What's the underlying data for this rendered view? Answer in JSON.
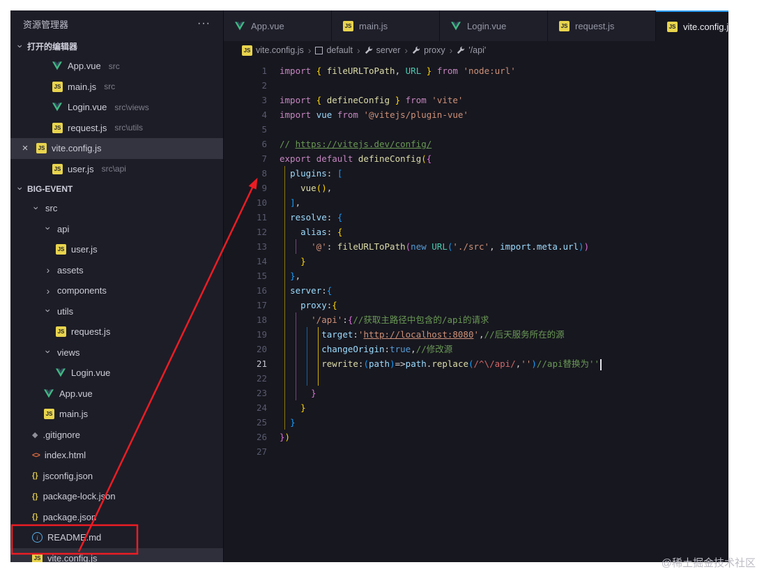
{
  "watermark": "@稀土掘金技术社区",
  "sidebar": {
    "title": "资源管理器",
    "more_icon": "···",
    "sections": {
      "open_editors": {
        "label": "打开的编辑器"
      },
      "workspace": {
        "label": "BIG-EVENT"
      }
    },
    "open_editors": [
      {
        "name": "App.vue",
        "path": "src",
        "icon": "vue"
      },
      {
        "name": "main.js",
        "path": "src",
        "icon": "js"
      },
      {
        "name": "Login.vue",
        "path": "src\\views",
        "icon": "vue"
      },
      {
        "name": "request.js",
        "path": "src\\utils",
        "icon": "js"
      },
      {
        "name": "vite.config.js",
        "path": "",
        "icon": "js",
        "active": true
      },
      {
        "name": "user.js",
        "path": "src\\api",
        "icon": "js"
      }
    ],
    "tree": [
      {
        "name": "src",
        "type": "folder",
        "expanded": true,
        "indent": 1
      },
      {
        "name": "api",
        "type": "folder",
        "expanded": true,
        "indent": 2
      },
      {
        "name": "user.js",
        "type": "file",
        "icon": "js",
        "indent": 3
      },
      {
        "name": "assets",
        "type": "folder",
        "expanded": false,
        "indent": 2
      },
      {
        "name": "components",
        "type": "folder",
        "expanded": false,
        "indent": 2
      },
      {
        "name": "utils",
        "type": "folder",
        "expanded": true,
        "indent": 2
      },
      {
        "name": "request.js",
        "type": "file",
        "icon": "js",
        "indent": 3
      },
      {
        "name": "views",
        "type": "folder",
        "expanded": true,
        "indent": 2
      },
      {
        "name": "Login.vue",
        "type": "file",
        "icon": "vue",
        "indent": 3
      },
      {
        "name": "App.vue",
        "type": "file",
        "icon": "vue",
        "indent": 2
      },
      {
        "name": "main.js",
        "type": "file",
        "icon": "js",
        "indent": 2
      },
      {
        "name": ".gitignore",
        "type": "file",
        "icon": "git",
        "indent": 1
      },
      {
        "name": "index.html",
        "type": "file",
        "icon": "html",
        "indent": 1
      },
      {
        "name": "jsconfig.json",
        "type": "file",
        "icon": "json",
        "indent": 1
      },
      {
        "name": "package-lock.json",
        "type": "file",
        "icon": "json",
        "indent": 1
      },
      {
        "name": "package.json",
        "type": "file",
        "icon": "json",
        "indent": 1
      },
      {
        "name": "README.md",
        "type": "file",
        "icon": "md",
        "indent": 1,
        "annotated": true
      },
      {
        "name": "vite.config.js",
        "type": "file",
        "icon": "js",
        "indent": 1,
        "selected": true
      }
    ]
  },
  "tabs": [
    {
      "label": "App.vue",
      "icon": "vue"
    },
    {
      "label": "main.js",
      "icon": "js"
    },
    {
      "label": "Login.vue",
      "icon": "vue"
    },
    {
      "label": "request.js",
      "icon": "js"
    },
    {
      "label": "vite.config.js",
      "icon": "js",
      "active": true
    }
  ],
  "breadcrumb": {
    "separator": "›",
    "items": [
      {
        "label": "vite.config.js",
        "icon": "js"
      },
      {
        "label": "default",
        "icon": "box"
      },
      {
        "label": "server",
        "icon": "wrench"
      },
      {
        "label": "proxy",
        "icon": "wrench"
      },
      {
        "label": "'/api'",
        "icon": "wrench"
      }
    ]
  },
  "editor": {
    "cursor_line": 21,
    "lines": [
      [
        [
          "kw",
          "import"
        ],
        [
          "pun",
          " "
        ],
        [
          "b1",
          "{"
        ],
        [
          "pun",
          " "
        ],
        [
          "fn",
          "fileURLToPath"
        ],
        [
          "pun",
          ", "
        ],
        [
          "cl",
          "URL"
        ],
        [
          "pun",
          " "
        ],
        [
          "b1",
          "}"
        ],
        [
          "pun",
          " "
        ],
        [
          "kw",
          "from"
        ],
        [
          "pun",
          " "
        ],
        [
          "st",
          "'node:url'"
        ]
      ],
      [],
      [
        [
          "kw",
          "import"
        ],
        [
          "pun",
          " "
        ],
        [
          "b1",
          "{"
        ],
        [
          "pun",
          " "
        ],
        [
          "fn",
          "defineConfig"
        ],
        [
          "pun",
          " "
        ],
        [
          "b1",
          "}"
        ],
        [
          "pun",
          " "
        ],
        [
          "kw",
          "from"
        ],
        [
          "pun",
          " "
        ],
        [
          "st",
          "'vite'"
        ]
      ],
      [
        [
          "kw",
          "import"
        ],
        [
          "pun",
          " "
        ],
        [
          "vb",
          "vue"
        ],
        [
          "pun",
          " "
        ],
        [
          "kw",
          "from"
        ],
        [
          "pun",
          " "
        ],
        [
          "st",
          "'@vitejs/plugin-vue'"
        ]
      ],
      [],
      [
        [
          "cm",
          "// "
        ],
        [
          "cmu",
          "https://vitejs.dev/config/"
        ]
      ],
      [
        [
          "kw",
          "export"
        ],
        [
          "pun",
          " "
        ],
        [
          "kw",
          "default"
        ],
        [
          "pun",
          " "
        ],
        [
          "fn",
          "defineConfig"
        ],
        [
          "b1",
          "("
        ],
        [
          "b2",
          "{"
        ]
      ],
      [
        [
          "pun",
          "  "
        ],
        [
          "vb",
          "plugins"
        ],
        [
          "pun",
          ": "
        ],
        [
          "b3",
          "["
        ]
      ],
      [
        [
          "pun",
          "    "
        ],
        [
          "fn",
          "vue"
        ],
        [
          "b1",
          "("
        ],
        [
          "b1",
          ")"
        ],
        [
          "pun",
          ","
        ]
      ],
      [
        [
          "pun",
          "  "
        ],
        [
          "b3",
          "]"
        ],
        [
          "pun",
          ","
        ]
      ],
      [
        [
          "pun",
          "  "
        ],
        [
          "vb",
          "resolve"
        ],
        [
          "pun",
          ": "
        ],
        [
          "b3",
          "{"
        ]
      ],
      [
        [
          "pun",
          "    "
        ],
        [
          "vb",
          "alias"
        ],
        [
          "pun",
          ": "
        ],
        [
          "b1",
          "{"
        ]
      ],
      [
        [
          "pun",
          "      "
        ],
        [
          "st",
          "'@'"
        ],
        [
          "pun",
          ": "
        ],
        [
          "fn",
          "fileURLToPath"
        ],
        [
          "b2",
          "("
        ],
        [
          "kb",
          "new"
        ],
        [
          "pun",
          " "
        ],
        [
          "cl",
          "URL"
        ],
        [
          "b3",
          "("
        ],
        [
          "st",
          "'./src'"
        ],
        [
          "pun",
          ", "
        ],
        [
          "vb",
          "import"
        ],
        [
          "pun",
          "."
        ],
        [
          "vb",
          "meta"
        ],
        [
          "pun",
          "."
        ],
        [
          "vb",
          "url"
        ],
        [
          "b3",
          ")"
        ],
        [
          "b2",
          ")"
        ]
      ],
      [
        [
          "pun",
          "    "
        ],
        [
          "b1",
          "}"
        ]
      ],
      [
        [
          "pun",
          "  "
        ],
        [
          "b3",
          "}"
        ],
        [
          "pun",
          ","
        ]
      ],
      [
        [
          "pun",
          "  "
        ],
        [
          "vb",
          "server"
        ],
        [
          "pun",
          ":"
        ],
        [
          "b3",
          "{"
        ]
      ],
      [
        [
          "pun",
          "    "
        ],
        [
          "vb",
          "proxy"
        ],
        [
          "pun",
          ":"
        ],
        [
          "b1",
          "{"
        ]
      ],
      [
        [
          "pun",
          "      "
        ],
        [
          "st",
          "'/api'"
        ],
        [
          "pun",
          ":"
        ],
        [
          "b2",
          "{"
        ],
        [
          "cm",
          "//获取主路径中包含的/api的请求"
        ]
      ],
      [
        [
          "pun",
          "        "
        ],
        [
          "vb",
          "target"
        ],
        [
          "pun",
          ":"
        ],
        [
          "st",
          "'"
        ],
        [
          "stu",
          "http://localhost:8080"
        ],
        [
          "st",
          "'"
        ],
        [
          "pun",
          ","
        ],
        [
          "cm",
          "//后天服务所在的源"
        ]
      ],
      [
        [
          "pun",
          "        "
        ],
        [
          "vb",
          "changeOrigin"
        ],
        [
          "pun",
          ":"
        ],
        [
          "kb",
          "true"
        ],
        [
          "pun",
          ","
        ],
        [
          "cm",
          "//修改源"
        ]
      ],
      [
        [
          "pun",
          "        "
        ],
        [
          "fn",
          "rewrite"
        ],
        [
          "pun",
          ":"
        ],
        [
          "b3",
          "("
        ],
        [
          "vb",
          "path"
        ],
        [
          "b3",
          ")"
        ],
        [
          "pun",
          "=>"
        ],
        [
          "vb",
          "path"
        ],
        [
          "pun",
          "."
        ],
        [
          "fn",
          "replace"
        ],
        [
          "b3",
          "("
        ],
        [
          "rx",
          "/^\\/api/"
        ],
        [
          "pun",
          ","
        ],
        [
          "st",
          "''"
        ],
        [
          "b3",
          ")"
        ],
        [
          "cm",
          "//api替换为''"
        ]
      ],
      [],
      [
        [
          "pun",
          "      "
        ],
        [
          "b2",
          "}"
        ]
      ],
      [
        [
          "pun",
          "    "
        ],
        [
          "b1",
          "}"
        ]
      ],
      [
        [
          "pun",
          "  "
        ],
        [
          "b3",
          "}"
        ]
      ],
      [
        [
          "b2",
          "}"
        ],
        [
          "b1",
          ")"
        ]
      ],
      []
    ]
  }
}
